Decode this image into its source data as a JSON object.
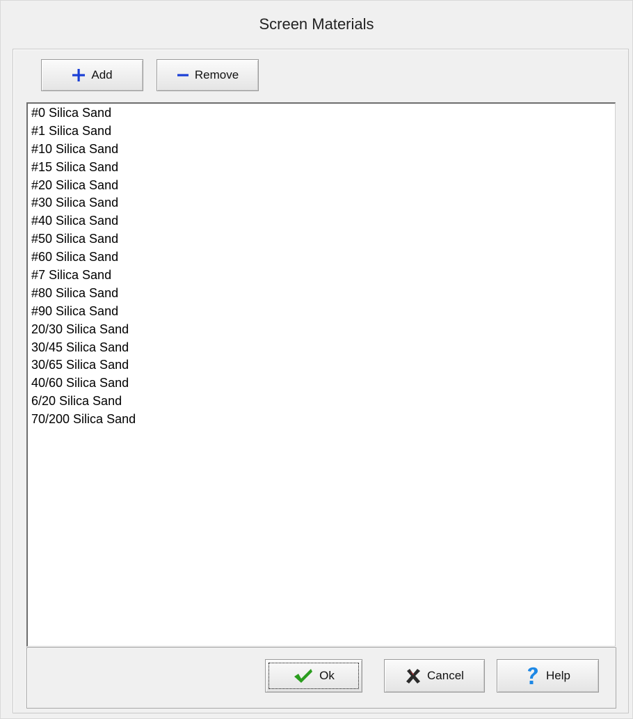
{
  "dialog": {
    "title": "Screen Materials"
  },
  "toolbar": {
    "add_label": "Add",
    "add_icon": "plus-icon",
    "remove_label": "Remove",
    "remove_icon": "minus-icon"
  },
  "materials": {
    "items": [
      "#0 Silica Sand",
      "#1 Silica Sand",
      "#10 Silica Sand",
      "#15 Silica Sand",
      "#20 Silica Sand",
      "#30 Silica Sand",
      "#40 Silica Sand",
      "#50 Silica Sand",
      "#60 Silica Sand",
      "#7 Silica Sand",
      "#80 Silica Sand",
      "#90 Silica Sand",
      "20/30 Silica Sand",
      "30/45 Silica Sand",
      "30/65 Silica Sand",
      "40/60 Silica Sand",
      "6/20 Silica Sand",
      "70/200 Silica Sand"
    ]
  },
  "footer": {
    "ok_label": "Ok",
    "ok_icon": "checkmark-icon",
    "cancel_label": "Cancel",
    "cancel_icon": "x-icon",
    "help_label": "Help",
    "help_icon": "question-mark-icon"
  },
  "colors": {
    "plus_minus": "#1a3fd6",
    "check": "#2a9d1e",
    "cancel_x": "#2b2b2b",
    "help_q": "#1e88e5"
  }
}
